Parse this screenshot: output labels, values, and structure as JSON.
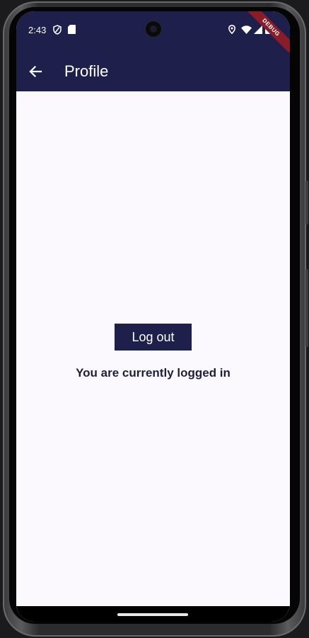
{
  "status_bar": {
    "time": "2:43",
    "icons_left": [
      "shield-icon",
      "sd-card-icon"
    ],
    "icons_right": [
      "location-icon",
      "wifi-icon",
      "signal-icon",
      "battery-icon"
    ]
  },
  "debug_banner": {
    "label": "DEBUG"
  },
  "app_bar": {
    "back_icon": "arrow-left-icon",
    "title": "Profile"
  },
  "main": {
    "logout_label": "Log out",
    "status_message": "You are currently logged in"
  },
  "colors": {
    "primary": "#1e1f4b",
    "background": "#fcf9fe",
    "text": "#1e1f3a",
    "debug": "#8a1c2a"
  }
}
